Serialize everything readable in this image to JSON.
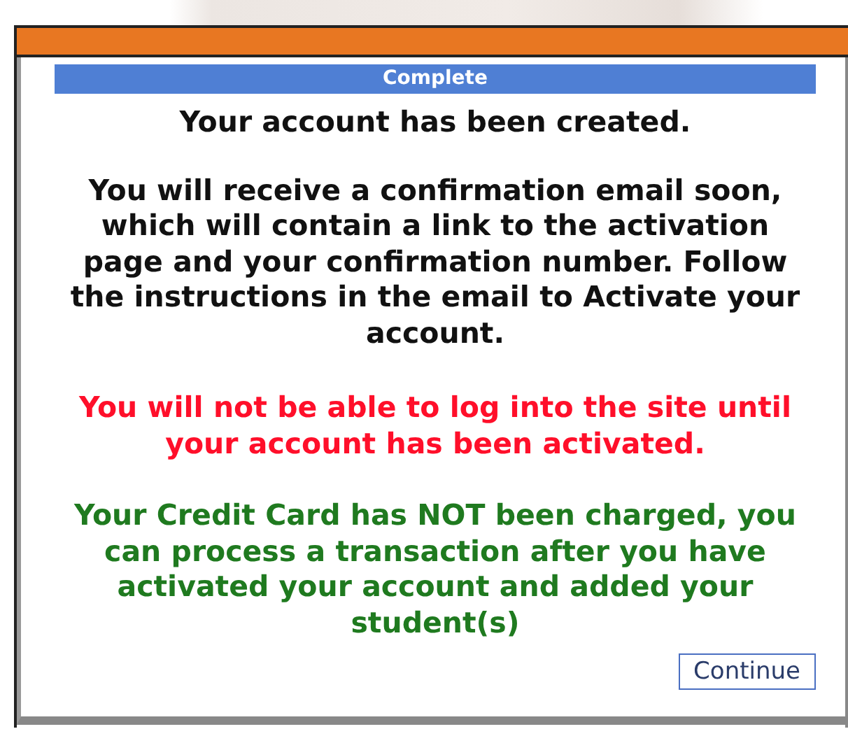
{
  "dialog": {
    "title": "Complete",
    "paragraphs": [
      {
        "kind": "heading",
        "text": "Your account has been created."
      },
      {
        "kind": "info",
        "text": "You will receive a confirmation email soon, which will contain a link to the activation page and your confirmation number.  Follow the instructions in the email to Activate your account."
      },
      {
        "kind": "warning",
        "text": "You will not be able to log into the site until your account has been activated."
      },
      {
        "kind": "note",
        "text": "Your Credit Card has NOT been charged, you can process a transaction after you have activated your account and added your student(s)"
      }
    ],
    "buttons": [
      "Continue"
    ]
  }
}
